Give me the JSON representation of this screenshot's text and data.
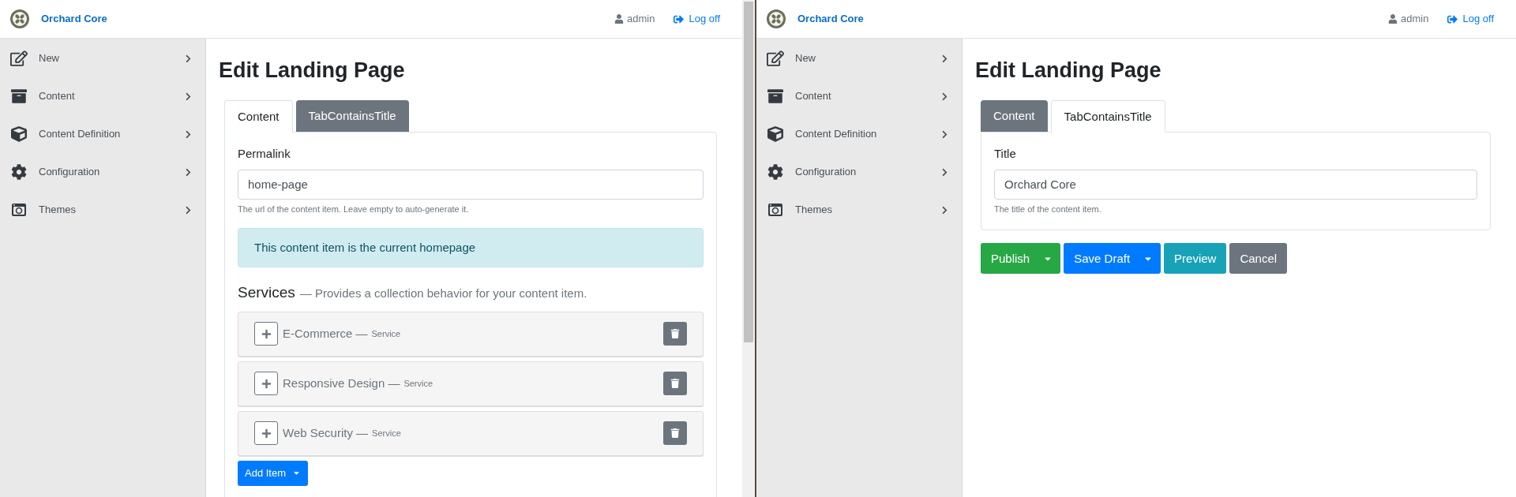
{
  "windows": [
    {
      "brand": "Orchard Core",
      "user": "admin",
      "logoff": "Log off",
      "menu": [
        {
          "label": "New"
        },
        {
          "label": "Content"
        },
        {
          "label": "Content Definition"
        },
        {
          "label": "Configuration"
        },
        {
          "label": "Themes"
        }
      ],
      "title": "Edit Landing Page",
      "tabs": [
        {
          "label": "Content",
          "selected": true
        },
        {
          "label": "TabContainsTitle",
          "selected": false
        }
      ],
      "panel": {
        "label": "Permalink",
        "value": "home-page",
        "hint": "The url of the content item. Leave empty to auto-generate it.",
        "alert": "This content item is the current homepage",
        "section": {
          "title": "Services",
          "description": "— Provides a collection behavior for your content item.",
          "add_button": "Add Item",
          "items": [
            {
              "name": "E-Commerce —",
              "type": "Service"
            },
            {
              "name": "Responsive Design —",
              "type": "Service"
            },
            {
              "name": "Web Security —",
              "type": "Service"
            }
          ]
        }
      }
    },
    {
      "brand": "Orchard Core",
      "user": "admin",
      "logoff": "Log off",
      "menu": [
        {
          "label": "New"
        },
        {
          "label": "Content"
        },
        {
          "label": "Content Definition"
        },
        {
          "label": "Configuration"
        },
        {
          "label": "Themes"
        }
      ],
      "title": "Edit Landing Page",
      "tabs": [
        {
          "label": "Content",
          "selected": false
        },
        {
          "label": "TabContainsTitle",
          "selected": true
        }
      ],
      "panel": {
        "label": "Title",
        "value": "Orchard Core",
        "hint": "The title of the content item."
      },
      "actions": [
        {
          "label": "Publish",
          "kind": "split",
          "color": "#28a745"
        },
        {
          "label": "Save Draft",
          "kind": "split",
          "color": "#007bff"
        },
        {
          "label": "Preview",
          "kind": "plain",
          "color": "#17a2b8"
        },
        {
          "label": "Cancel",
          "kind": "plain",
          "color": "#6c757d"
        }
      ]
    }
  ]
}
